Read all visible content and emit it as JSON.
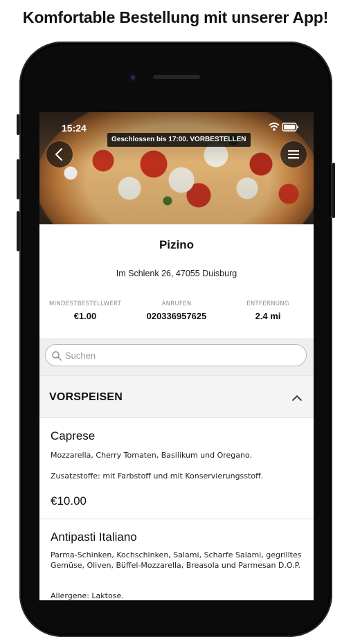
{
  "headline": "Komfortable Bestellung mit unserer App!",
  "status_bar": {
    "time": "15:24",
    "icons": [
      "wifi-icon",
      "battery-icon"
    ]
  },
  "banner": {
    "text": "Geschlossen bis 17:00. VORBESTELLEN"
  },
  "restaurant": {
    "name": "Pizino",
    "address": "Im Schlenk 26, 47055 Duisburg",
    "stats": [
      {
        "label": "MINDESTBESTELLWERT",
        "value": "€1.00"
      },
      {
        "label": "ANRUFEN",
        "value": "020336957625"
      },
      {
        "label": "ENTFERNUNG",
        "value": "2.4 mi"
      }
    ]
  },
  "search": {
    "placeholder": "Suchen",
    "value": ""
  },
  "category": {
    "title": "VORSPEISEN",
    "expanded": true
  },
  "items": [
    {
      "name": "Caprese",
      "description": "Mozzarella, Cherry Tomaten, Basilikum und Oregano.",
      "additives": "Zusatzstoffe: mit Farbstoff und mit Konservierungsstoff.",
      "price": "€10.00"
    },
    {
      "name": "Antipasti Italiano",
      "description": "Parma-Schinken, Kochschinken, Salami, Scharfe Salami, gegrilltes Gemüse, Oliven, Büffel-Mozzarella, Breasola und Parmesan D.O.P.",
      "allergens": "Allergene: Laktose."
    }
  ],
  "colors": {
    "phone_frame": "#0b0b0b",
    "search_bg": "#efefef",
    "category_bg": "#f4f4f4",
    "text": "#111111"
  }
}
